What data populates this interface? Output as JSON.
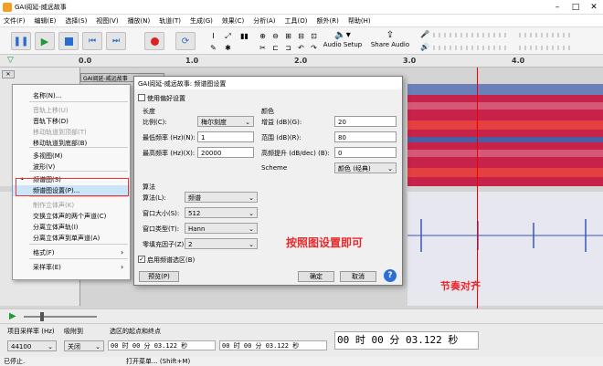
{
  "window": {
    "title": "GAI阅延-威远故事"
  },
  "menubar": [
    "文件(F)",
    "编辑(E)",
    "选择(S)",
    "视图(V)",
    "播放(N)",
    "轨道(T)",
    "生成(G)",
    "效果(C)",
    "分析(A)",
    "工具(O)",
    "额外(R)",
    "帮助(H)"
  ],
  "toolbar": {
    "audio_setup": "Audio Setup",
    "share_audio": "Share Audio"
  },
  "ruler": {
    "ticks": [
      "0.0",
      "1.0",
      "2.0",
      "3.0",
      "4.0"
    ]
  },
  "track": {
    "name": "GAI阅延-威远故事"
  },
  "context_menu": {
    "items": [
      {
        "label": "名称(N)...",
        "disabled": false
      },
      {
        "label": "音轨上移(U)",
        "disabled": true
      },
      {
        "label": "音轨下移(D)",
        "disabled": false
      },
      {
        "label": "移动轨道到顶部(T)",
        "disabled": true
      },
      {
        "label": "移动轨道到底部(B)",
        "disabled": false
      },
      {
        "label": "多视图(M)",
        "disabled": false
      },
      {
        "label": "波形(V)",
        "disabled": false
      },
      {
        "label": "频谱图(S)",
        "disabled": false
      },
      {
        "label": "频谱图设置(P)...",
        "disabled": false
      },
      {
        "label": "制作立体声(K)",
        "disabled": true
      },
      {
        "label": "交换立体声的两个声道(C)",
        "disabled": false
      },
      {
        "label": "分离立体声轨(I)",
        "disabled": false
      },
      {
        "label": "分离立体声到单声道(A)",
        "disabled": false
      },
      {
        "label": "格式(F)",
        "disabled": false
      },
      {
        "label": "采样率(E)",
        "disabled": false
      }
    ]
  },
  "dialog": {
    "title": "GAI阅延-威远故事: 频谱图设置",
    "use_prefs": "使用偏好设置",
    "scale_group": "长度",
    "scale_label": "比例(C):",
    "scale_value": "梅尔刻度",
    "min_freq_label": "最低频率 (Hz)(N):",
    "min_freq_value": "1",
    "max_freq_label": "最高频率 (Hz)(X):",
    "max_freq_value": "20000",
    "colors_group": "颜色",
    "gain_label": "增益 (dB)(G):",
    "gain_value": "20",
    "range_label": "范围 (dB)(R):",
    "range_value": "80",
    "freqgain_label": "高频提升 (dB/dec) (B):",
    "freqgain_value": "0",
    "scheme_label": "Scheme",
    "scheme_value": "颜色 (经典)",
    "algo_group": "算法",
    "algo_label": "算法(L):",
    "algo_value": "频谱",
    "window_size_label": "窗口大小(S):",
    "window_size_value": "512",
    "window_type_label": "窗口类型(T):",
    "window_type_value": "Hann",
    "zero_pad_label": "零填充因子(Z):",
    "zero_pad_value": "2",
    "spectral_sel": "启用频谱选区(B)",
    "preview": "预览(P)",
    "ok": "确定",
    "cancel": "取消",
    "help": "?"
  },
  "annotations": {
    "dialog_note": "按照图设置即可",
    "align_note": "节奏对齐"
  },
  "selection_bar": {
    "rate_label": "项目采样率 (Hz)",
    "snap_label": "吸附到",
    "rate_value": "44100",
    "snap_value": "关闭",
    "sel_label": "选区的起点和终点",
    "start_time": "00 时 00 分 03.122 秒",
    "end_time": "00 时 00 分 03.122 秒",
    "big_time": "00 时 00 分 03.122 秒"
  },
  "status": {
    "left": "已停止.",
    "hint": "打开菜单... (Shift+M)"
  }
}
